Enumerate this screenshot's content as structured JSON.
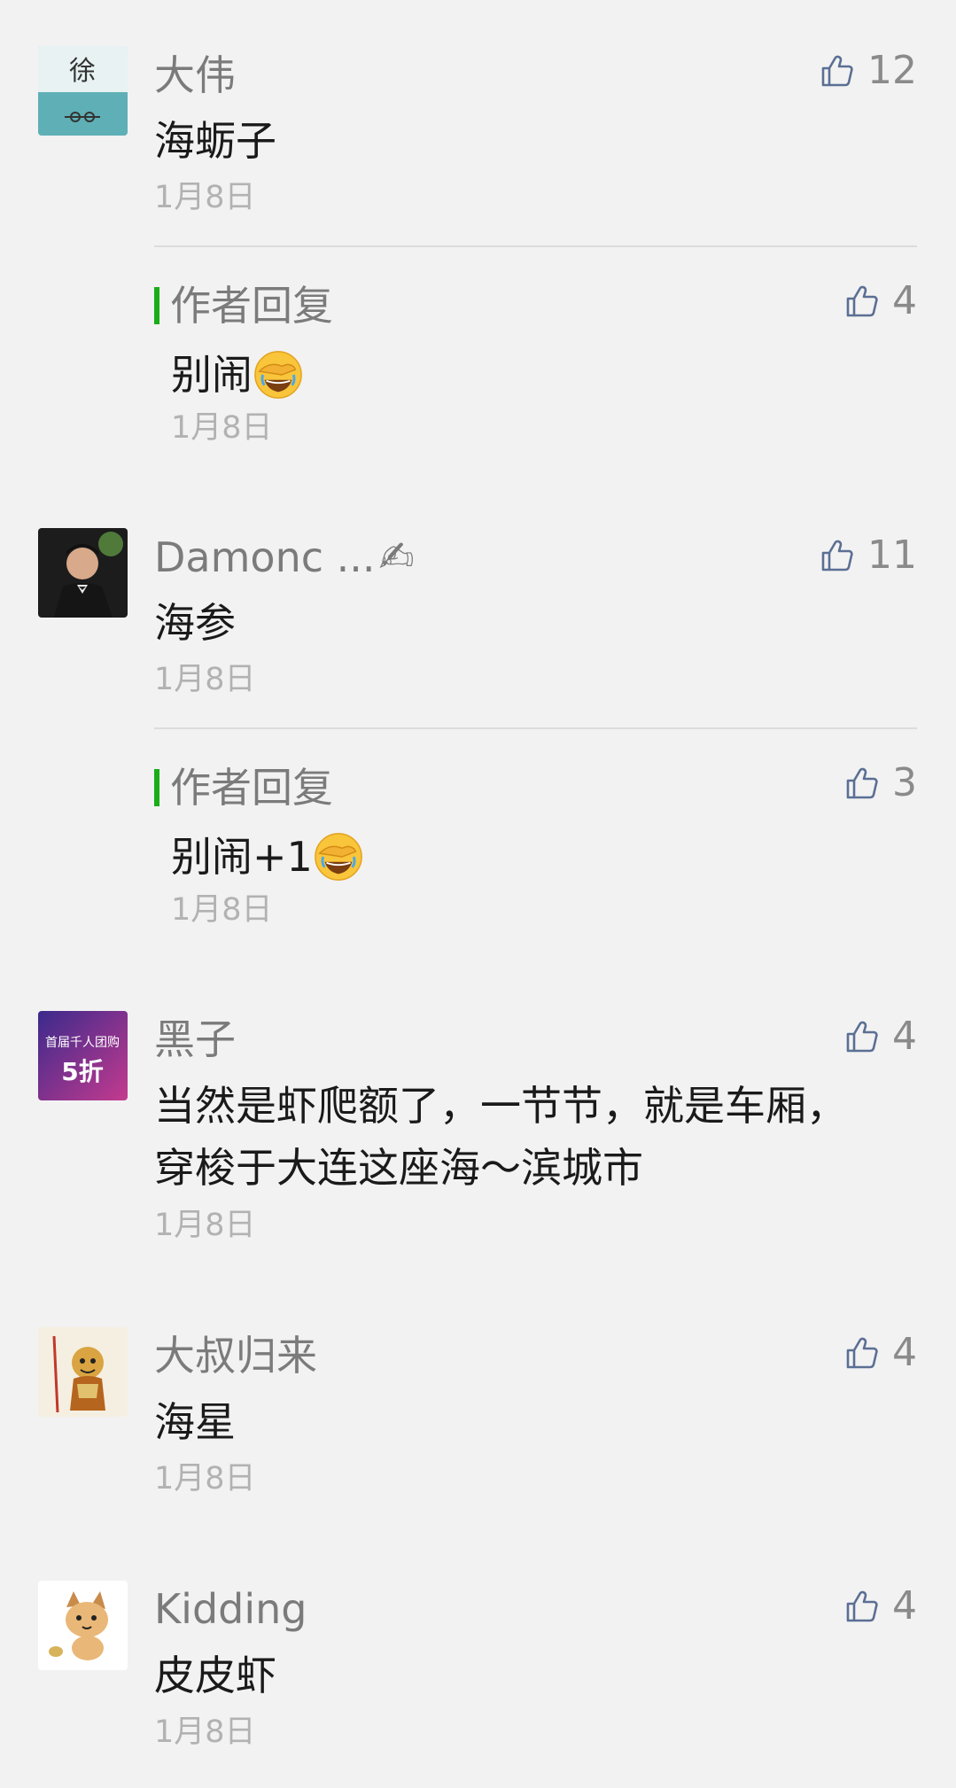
{
  "comments": [
    {
      "name": "大伟",
      "text": "海蛎子",
      "date": "1月8日",
      "likes": "12",
      "avatar_text": "徐",
      "reply": {
        "label": "作者回复",
        "text": "别闹",
        "date": "1月8日",
        "likes": "4"
      }
    },
    {
      "name": "Damonc ...",
      "text": "海参",
      "date": "1月8日",
      "likes": "11",
      "reply": {
        "label": "作者回复",
        "text": "别闹+1",
        "date": "1月8日",
        "likes": "3"
      }
    },
    {
      "name": "黑子",
      "text_line1": "当然是虾爬额了，一节节，就是车厢，",
      "text_line2": "穿梭于大连这座海～滨城市",
      "date": "1月8日",
      "likes": "4",
      "avatar_text1": "首届千人团购",
      "avatar_text2": "5折"
    },
    {
      "name": "大叔归来",
      "text": "海星",
      "date": "1月8日",
      "likes": "4"
    },
    {
      "name": "Kidding",
      "text": "皮皮虾",
      "date": "1月8日",
      "likes": "4"
    }
  ],
  "colors": {
    "background": "#f2f2f2",
    "reply_bar": "#19ad19",
    "name": "#7b7b7b",
    "date": "#b2b2b2"
  }
}
